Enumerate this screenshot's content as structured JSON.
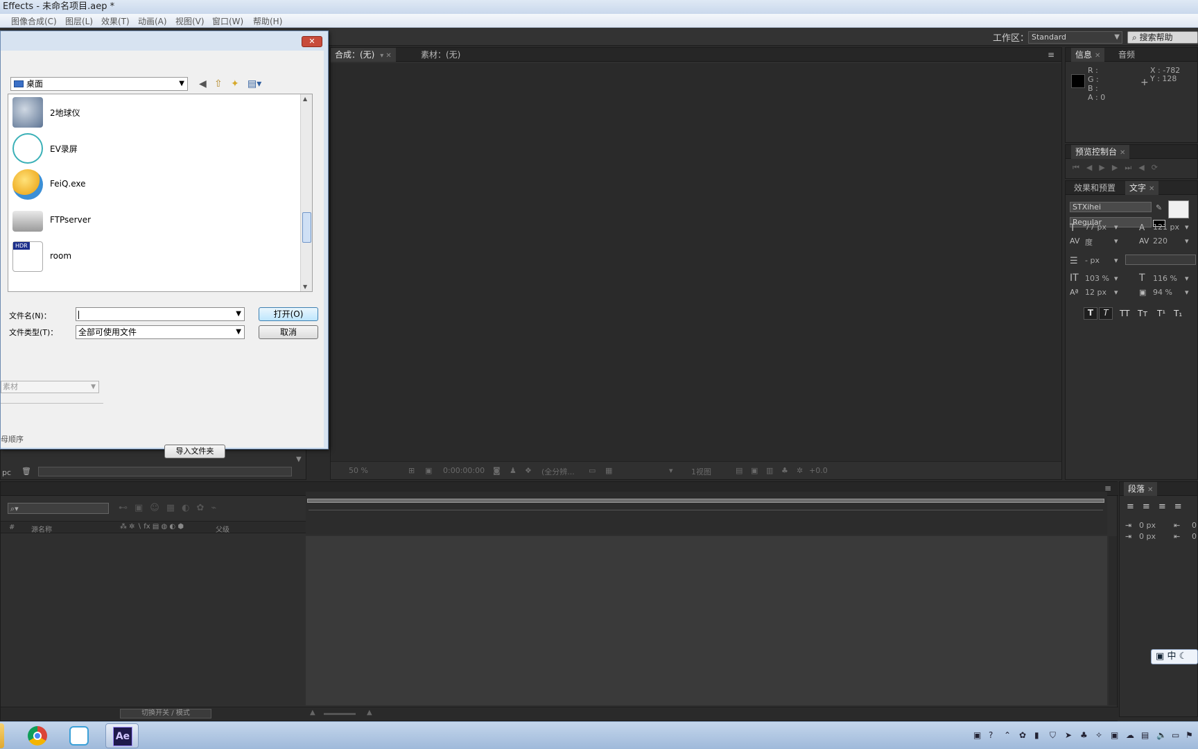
{
  "window": {
    "title": "Effects - 未命名项目.aep *",
    "menu": [
      "图像合成(C)",
      "图层(L)",
      "效果(T)",
      "动画(A)",
      "视图(V)",
      "窗口(W)",
      "帮助(H)"
    ]
  },
  "workspace": {
    "label": "工作区：",
    "value": "Standard",
    "search_label": "搜索帮助"
  },
  "comp_panel": {
    "tab_comp": "合成：(无)",
    "tab_footage": "素材：(无)",
    "footer": {
      "zoom": "50 %",
      "time": "0:00:00:00",
      "resolution": "(全分辨...",
      "views": "1视图",
      "exposure": "+0.0"
    }
  },
  "info_panel": {
    "tab_info": "信息",
    "tab_audio": "音频",
    "r": "R :",
    "g": "G :",
    "b": "B :",
    "a": "A : 0",
    "x": "X : -782",
    "y": "Y : 128"
  },
  "preview_panel": {
    "tab": "预览控制台"
  },
  "character_panel": {
    "tab_effects": "效果和预置",
    "tab_text": "文字",
    "font": "STXihei",
    "style": "Regular",
    "size_value": "77",
    "size_unit": "px",
    "leading_value": "121",
    "leading_unit": "px",
    "kerning_value": "度",
    "tracking_value": "220",
    "stroke_value": "- px",
    "vscale_value": "103",
    "vscale_unit": "%",
    "hscale_value": "116",
    "hscale_unit": "%",
    "baseline_value": "12",
    "baseline_unit": "px",
    "tsume_value": "94",
    "tsume_unit": "%",
    "styles": [
      "T",
      "T",
      "TT",
      "Tт",
      "T¹",
      "T₁"
    ]
  },
  "paragraph_panel": {
    "tab": "段落",
    "indent_left": "0 px",
    "indent_first": "0 px",
    "right_values": [
      "0",
      "0"
    ]
  },
  "timeline": {
    "col_num": "#",
    "col_source": "源名称",
    "col_parent": "父级",
    "switch_mode": "切换开关 / 模式"
  },
  "project_panel": {
    "footage_select": "素材",
    "order_label": "母顺序",
    "bpc": "pc",
    "import_folder": "导入文件夹"
  },
  "dialog": {
    "look_in": "桌面",
    "files": [
      {
        "name": "2地球仪"
      },
      {
        "name": "EV录屏"
      },
      {
        "name": "FeiQ.exe"
      },
      {
        "name": "FTPserver"
      },
      {
        "name": "room",
        "badge": "HDR"
      }
    ],
    "filename_label": "文件名(N)：",
    "filename_value": "",
    "filetype_label": "文件类型(T)：",
    "filetype_value": "全部可使用文件",
    "open_button": "打开(O)",
    "cancel_button": "取消",
    "close_glyph": "✕"
  },
  "ime": {
    "text": "中"
  },
  "taskbar": {
    "ae_label": "Ae"
  },
  "colors": {
    "accent_orange": "#d39a2f",
    "panel_bg": "#2f2f2f",
    "dialog_bg": "#f0f0f0"
  }
}
